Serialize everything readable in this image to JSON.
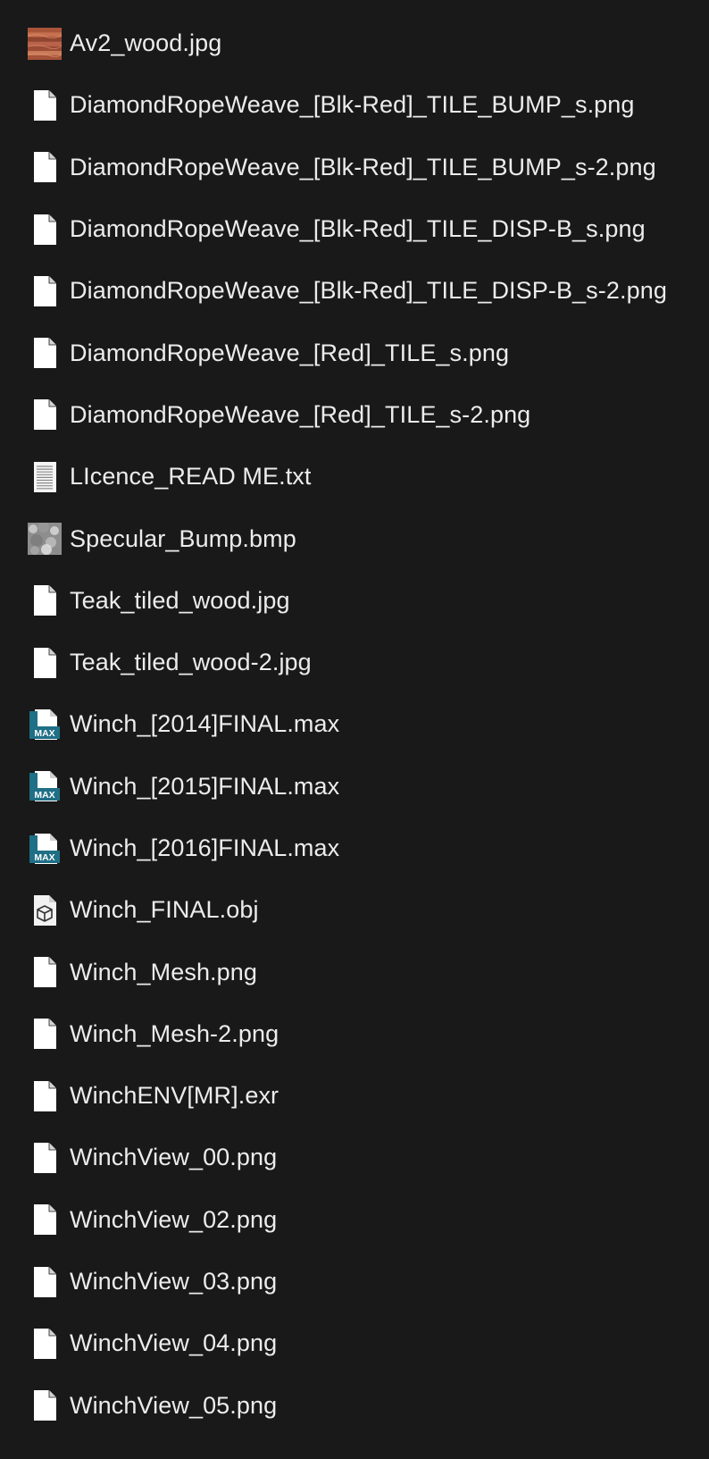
{
  "files": [
    {
      "name": "Av2_wood.jpg",
      "icon": "wood-thumbnail-icon"
    },
    {
      "name": "DiamondRopeWeave_[Blk-Red]_TILE_BUMP_s.png",
      "icon": "file-icon"
    },
    {
      "name": "DiamondRopeWeave_[Blk-Red]_TILE_BUMP_s-2.png",
      "icon": "file-icon"
    },
    {
      "name": "DiamondRopeWeave_[Blk-Red]_TILE_DISP-B_s.png",
      "icon": "file-icon"
    },
    {
      "name": "DiamondRopeWeave_[Blk-Red]_TILE_DISP-B_s-2.png",
      "icon": "file-icon"
    },
    {
      "name": "DiamondRopeWeave_[Red]_TILE_s.png",
      "icon": "file-icon"
    },
    {
      "name": "DiamondRopeWeave_[Red]_TILE_s-2.png",
      "icon": "file-icon"
    },
    {
      "name": "LIcence_READ ME.txt",
      "icon": "text-file-icon"
    },
    {
      "name": "Specular_Bump.bmp",
      "icon": "bump-thumbnail-icon"
    },
    {
      "name": "Teak_tiled_wood.jpg",
      "icon": "file-icon"
    },
    {
      "name": "Teak_tiled_wood-2.jpg",
      "icon": "file-icon"
    },
    {
      "name": "Winch_[2014]FINAL.max",
      "icon": "max-file-icon",
      "badge": "MAX"
    },
    {
      "name": "Winch_[2015]FINAL.max",
      "icon": "max-file-icon",
      "badge": "MAX"
    },
    {
      "name": "Winch_[2016]FINAL.max",
      "icon": "max-file-icon",
      "badge": "MAX"
    },
    {
      "name": "Winch_FINAL.obj",
      "icon": "3d-object-file-icon"
    },
    {
      "name": "Winch_Mesh.png",
      "icon": "file-icon"
    },
    {
      "name": "Winch_Mesh-2.png",
      "icon": "file-icon"
    },
    {
      "name": "WinchENV[MR].exr",
      "icon": "file-icon"
    },
    {
      "name": "WinchView_00.png",
      "icon": "file-icon"
    },
    {
      "name": "WinchView_02.png",
      "icon": "file-icon"
    },
    {
      "name": "WinchView_03.png",
      "icon": "file-icon"
    },
    {
      "name": "WinchView_04.png",
      "icon": "file-icon"
    },
    {
      "name": "WinchView_05.png",
      "icon": "file-icon"
    }
  ],
  "colors": {
    "background": "#191919",
    "text": "#ececec",
    "file_icon": "#ffffff",
    "max_badge": "#1f6f86"
  }
}
